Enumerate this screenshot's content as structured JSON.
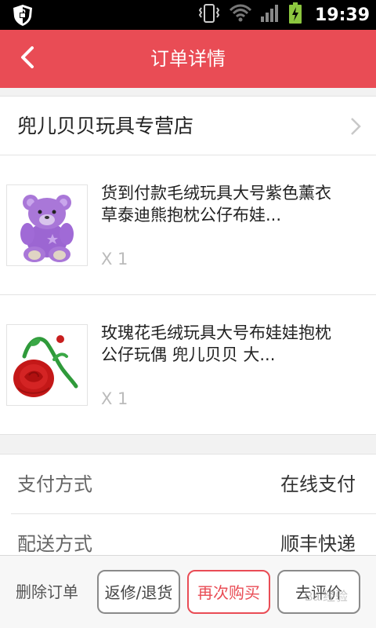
{
  "status_bar": {
    "time": "19:39",
    "icons": [
      "shield-icon",
      "vibrate-icon",
      "wifi-icon",
      "signal-icon",
      "battery-charging-icon"
    ]
  },
  "header": {
    "title": "订单详情",
    "back_icon": "chevron-left-icon",
    "background_color": "#e94c55"
  },
  "shop": {
    "name": "兜儿贝贝玩具专营店",
    "chevron_icon": "chevron-right-icon"
  },
  "products": [
    {
      "name": "货到付款毛绒玩具大号紫色薰衣草泰迪熊抱枕公仔布娃...",
      "qty": "X 1",
      "image": "purple-teddy-bear"
    },
    {
      "name": "玫瑰花毛绒玩具大号布娃娃抱枕公仔玩偶 兜儿贝贝 大...",
      "qty": "X 1",
      "image": "red-rose-plush"
    }
  ],
  "info": [
    {
      "label": "支付方式",
      "value": "在线支付"
    },
    {
      "label": "配送方式",
      "value": "顺丰快递"
    }
  ],
  "bottom_bar": {
    "delete_label": "删除订单",
    "buttons": [
      {
        "label": "返修/退货"
      },
      {
        "label": "再次购买",
        "accent": "#e94c55"
      },
      {
        "label": "去评价"
      }
    ]
  },
  "watermark": "Bai经验"
}
